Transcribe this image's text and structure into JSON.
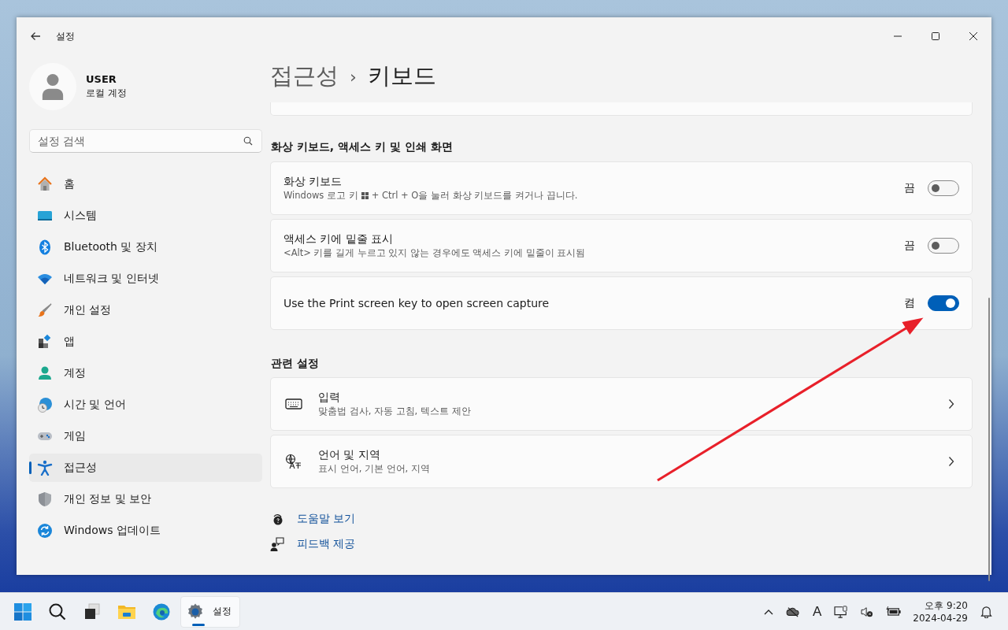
{
  "window": {
    "title": "설정"
  },
  "user": {
    "name": "USER",
    "account_type": "로컬 계정"
  },
  "search": {
    "placeholder": "설정 검색"
  },
  "nav": [
    {
      "kind": "home",
      "label": "홈",
      "selected": false
    },
    {
      "kind": "system",
      "label": "시스템",
      "selected": false
    },
    {
      "kind": "bluetooth",
      "label": "Bluetooth 및 장치",
      "selected": false
    },
    {
      "kind": "network",
      "label": "네트워크 및 인터넷",
      "selected": false
    },
    {
      "kind": "personalization",
      "label": "개인 설정",
      "selected": false
    },
    {
      "kind": "apps",
      "label": "앱",
      "selected": false
    },
    {
      "kind": "accounts",
      "label": "계정",
      "selected": false
    },
    {
      "kind": "time",
      "label": "시간 및 언어",
      "selected": false
    },
    {
      "kind": "gaming",
      "label": "게임",
      "selected": false
    },
    {
      "kind": "accessibility",
      "label": "접근성",
      "selected": true
    },
    {
      "kind": "privacy",
      "label": "개인 정보 및 보안",
      "selected": false
    },
    {
      "kind": "update",
      "label": "Windows 업데이트",
      "selected": false
    }
  ],
  "breadcrumb": {
    "parent": "접근성",
    "separator": "›",
    "current": "키보드"
  },
  "toggle_section": {
    "title": "화상 키보드, 액세스 키 및 인쇄 화면",
    "settings": [
      {
        "title": "화상 키보드",
        "description": [
          "Windows 로고 키",
          "+ Ctrl + O을 눌러 화상 키보드를 켜거나 끕니다."
        ],
        "state_label": "끔",
        "on": false
      },
      {
        "title": "액세스 키에 밑줄 표시",
        "description": [
          "<Alt> 키를 길게 누르고 있지 않는 경우에도 액세스 키에 밑줄이 표시됨"
        ],
        "state_label": "끔",
        "on": false
      },
      {
        "title": "Use the Print screen key to open screen capture",
        "state_label": "켬",
        "on": true
      }
    ]
  },
  "related_section": {
    "title": "관련 설정",
    "links": [
      {
        "kind": "keyboard",
        "title": "입력",
        "description": "맞춤법 검사, 자동 고침, 텍스트 제안"
      },
      {
        "kind": "language",
        "title": "언어 및 지역",
        "description": "표시 언어, 기본 언어, 지역"
      }
    ]
  },
  "help_links": [
    {
      "kind": "help",
      "label": "도움말 보기"
    },
    {
      "kind": "feedback",
      "label": "피드백 제공"
    }
  ],
  "taskbar": {
    "apps": [
      {
        "kind": "start",
        "selected": false
      },
      {
        "kind": "search",
        "selected": false
      },
      {
        "kind": "taskview",
        "selected": false
      },
      {
        "kind": "explorer",
        "selected": false
      },
      {
        "kind": "edge",
        "selected": false
      },
      {
        "kind": "settings",
        "label": "설정",
        "selected": true
      }
    ],
    "tray": {
      "ime": "A",
      "time": "오후 9:20",
      "date": "2024-04-29"
    }
  }
}
